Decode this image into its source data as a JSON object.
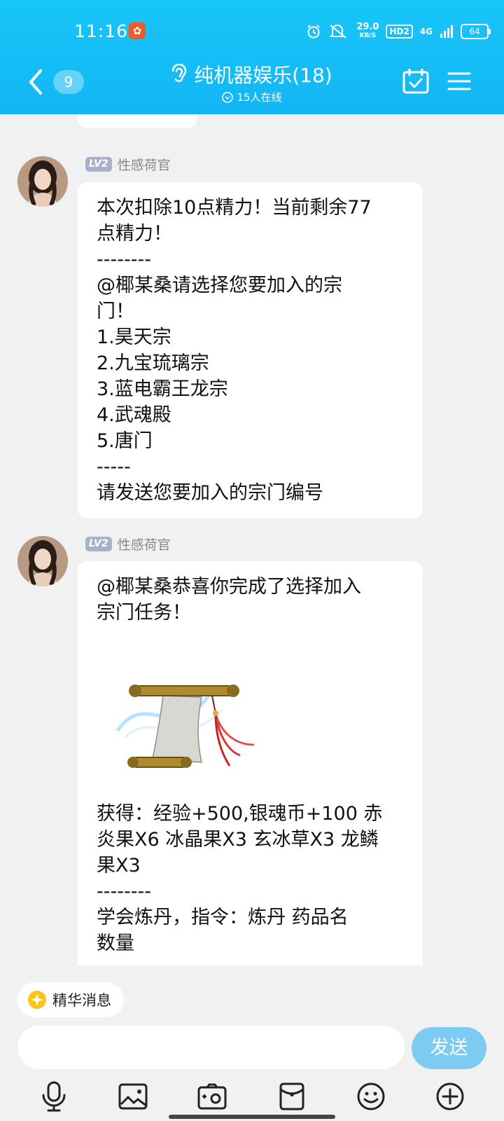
{
  "status_bar": {
    "time": "11:16",
    "notif_icon": "app-notification-icon",
    "speed_value": "29.0",
    "speed_unit": "KB/S",
    "hd_label": "HD2",
    "network_label": "4G",
    "battery": "64"
  },
  "header": {
    "unread_count": "9",
    "title": "纯机器娱乐(18)",
    "online_text": "15人在线"
  },
  "messages": [
    {
      "sender_level": "LV2",
      "sender_name": "性感荷官",
      "lines": [
        "本次扣除10点精力！当前剩余77",
        "点精力！",
        "--------",
        "@椰某桑请选择您要加入的宗",
        "门！",
        "1.昊天宗",
        "2.九宝琉璃宗",
        "3.蓝电霸王龙宗",
        "4.武魂殿",
        "5.唐门",
        "-----",
        "请发送您要加入的宗门编号"
      ]
    },
    {
      "sender_level": "LV2",
      "sender_name": "性感荷官",
      "lines_top": [
        "@椰某桑恭喜你完成了选择加入",
        "宗门任务！"
      ],
      "lines_bottom": [
        "获得：经验+500,银魂币+100 赤",
        "炎果X6 冰晶果X3 玄冰草X3 龙鳞",
        "果X3",
        "--------",
        "学会炼丹，指令：炼丹 药品名",
        "数量"
      ]
    }
  ],
  "bottom": {
    "essence_label": "精华消息",
    "input_value": "",
    "send_label": "发送",
    "tools": [
      "microphone-icon",
      "image-icon",
      "camera-icon",
      "red-packet-icon",
      "emoji-icon",
      "plus-icon"
    ]
  },
  "colors": {
    "header_bg": "#18c6f9",
    "send_btn": "#7ccbf3",
    "level_badge": "#a7b2c8"
  }
}
